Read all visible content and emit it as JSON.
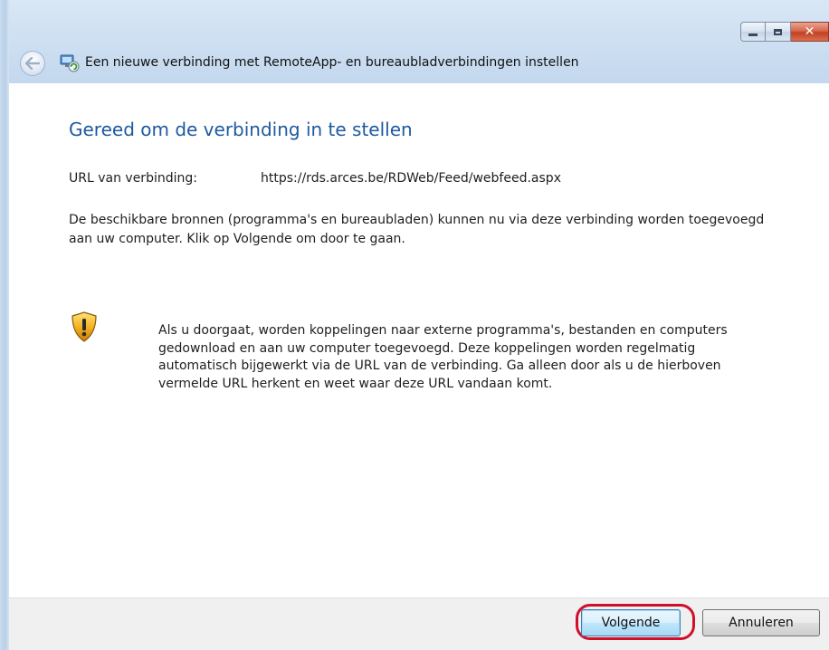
{
  "window": {
    "title": "Een nieuwe verbinding met RemoteApp- en bureaubladverbindingen instellen",
    "caption_buttons": {
      "minimize_icon": "minimize-icon",
      "maximize_icon": "maximize-icon",
      "close_icon": "close-icon",
      "close_glyph": "✕"
    },
    "back_icon": "back-arrow-icon",
    "app_icon": "remoteapp-connection-icon"
  },
  "main": {
    "heading": "Gereed om de verbinding in te stellen",
    "url_label": "URL van verbinding:",
    "url_value": "https://rds.arces.be/RDWeb/Feed/webfeed.aspx",
    "description": "De beschikbare bronnen (programma's en bureaubladen) kunnen nu via deze verbinding worden toegevoegd aan uw computer. Klik op Volgende om door te gaan.",
    "warning_icon": "security-shield-warning-icon",
    "warning_text": "Als u doorgaat, worden koppelingen naar externe programma's, bestanden en computers gedownload en aan uw computer toegevoegd. Deze koppelingen worden regelmatig automatisch bijgewerkt via de URL van de verbinding. Ga alleen door als u de hierboven vermelde URL herkent en weet waar deze URL vandaan komt."
  },
  "footer": {
    "next_label": "Volgende",
    "cancel_label": "Annuleren"
  },
  "colors": {
    "heading": "#1e5aa0",
    "highlight": "#d0102a",
    "titlebar": "#cfe0f2"
  }
}
